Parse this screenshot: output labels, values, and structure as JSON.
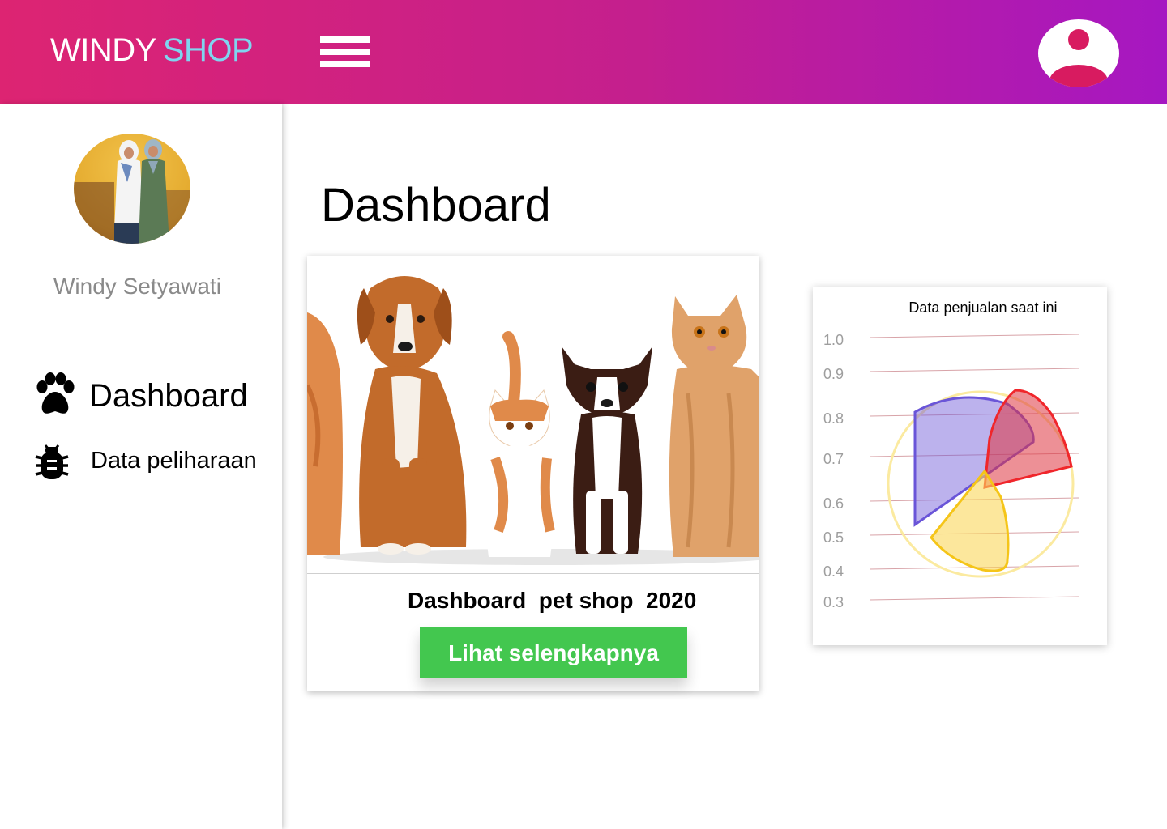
{
  "header": {
    "brand_part1": "WINDY",
    "brand_part2": "SHOP",
    "gradient_start": "#dd2472",
    "gradient_end": "#a617c2",
    "menu_icon": "hamburger-menu-icon",
    "user_icon": "user-account-icon"
  },
  "sidebar": {
    "profile_name": "Windy Setyawati",
    "items": [
      {
        "label": "Dashboard",
        "icon": "paw-icon"
      },
      {
        "label": "Data peliharaan",
        "icon": "bug-icon"
      }
    ]
  },
  "main": {
    "title": "Dashboard",
    "card": {
      "title": "Dashboard  pet shop  2020",
      "button_label": "Lihat selengkapnya",
      "button_color": "#43c74f"
    }
  },
  "chart_data": {
    "type": "polar-area",
    "title": "Data penjualan saat ini",
    "ticks": [
      "1.0",
      "0.9",
      "0.8",
      "0.7",
      "0.6",
      "0.5",
      "0.4",
      "0.3"
    ],
    "series": [
      {
        "color": "#6a55d8",
        "fill": "rgba(106,85,216,0.45)"
      },
      {
        "color": "#f0262b",
        "fill": "rgba(222,52,64,0.55)"
      },
      {
        "color": "#f5c518",
        "fill": "rgba(250,215,90,0.6)"
      }
    ]
  }
}
